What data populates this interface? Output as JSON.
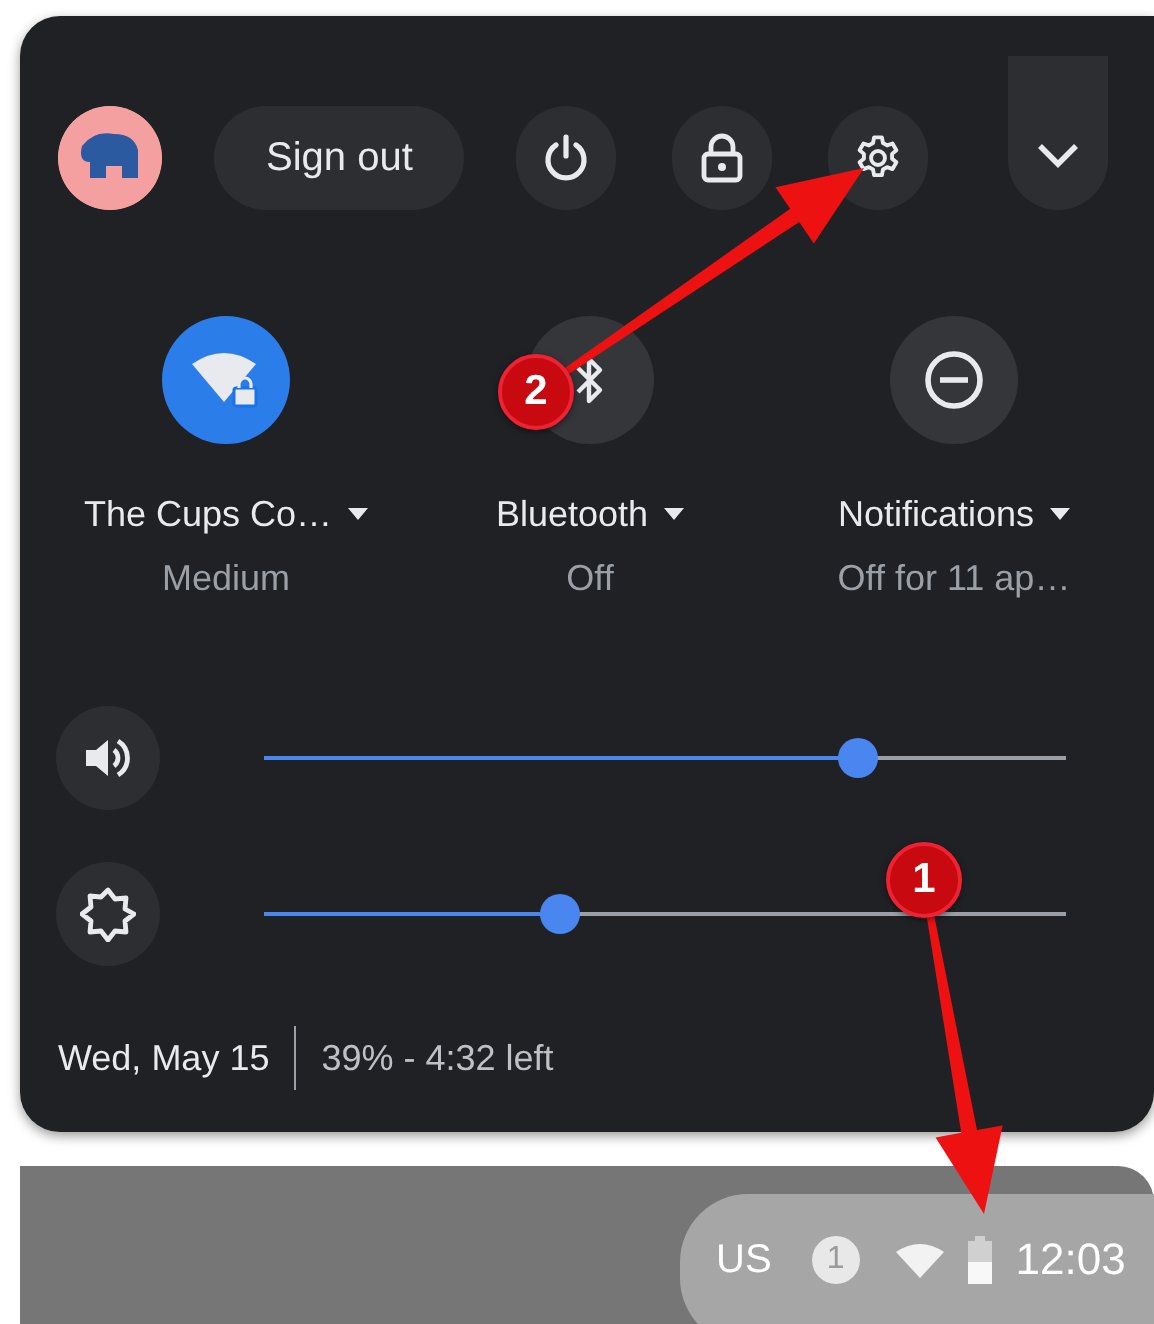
{
  "top_buttons": [
    {
      "kind": "text",
      "label": "Sign out"
    },
    {
      "kind": "power"
    },
    {
      "kind": "lock"
    },
    {
      "kind": "settings"
    },
    {
      "kind": "collapse"
    }
  ],
  "features": [
    {
      "kind": "wifi",
      "label": "The Cups Co…",
      "sublabel": "Medium",
      "on": true
    },
    {
      "kind": "bluetooth",
      "label": "Bluetooth",
      "sublabel": "Off",
      "on": false
    },
    {
      "kind": "notifications",
      "label": "Notifications",
      "sublabel": "Off for 11 ap…",
      "on": false
    }
  ],
  "sliders": [
    {
      "kind": "volume",
      "level": 0.74
    },
    {
      "kind": "brightness",
      "level": 0.37
    }
  ],
  "footer": {
    "date": "Wed, May 15",
    "battery": "39% - 4:32 left"
  },
  "shelf": {
    "keyboard": "US",
    "notification_count": "1",
    "time": "12:03"
  },
  "annotations": [
    {
      "label": "2"
    },
    {
      "label": "1"
    }
  ]
}
